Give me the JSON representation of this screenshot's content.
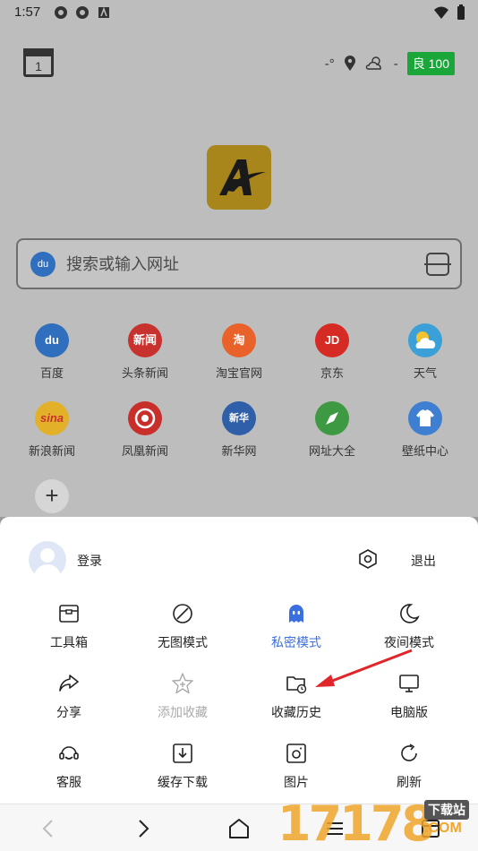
{
  "status_bar": {
    "time": "1:57"
  },
  "header": {
    "calendar_day": "1",
    "temperature": "-°",
    "weather_value": "-",
    "aqi": "良 100"
  },
  "search": {
    "placeholder": "搜索或输入网址"
  },
  "shortcuts": [
    {
      "label": "百度",
      "icon_text": "du",
      "color": "#2f6fbd"
    },
    {
      "label": "头条新闻",
      "icon_text": "新闻",
      "color": "#c8322e"
    },
    {
      "label": "淘宝官网",
      "icon_text": "淘",
      "color": "#e8622a"
    },
    {
      "label": "京东",
      "icon_text": "JD",
      "color": "#d62b24"
    },
    {
      "label": "天气",
      "icon_text": "",
      "color": "#3ba0d8"
    },
    {
      "label": "新浪新闻",
      "icon_text": "sina",
      "color": "#e2b129"
    },
    {
      "label": "凤凰新闻",
      "icon_text": "",
      "color": "#c92f2a"
    },
    {
      "label": "新华网",
      "icon_text": "新华",
      "color": "#2f5fa8"
    },
    {
      "label": "网址大全",
      "icon_text": "",
      "color": "#3e9a42"
    },
    {
      "label": "壁纸中心",
      "icon_text": "",
      "color": "#3f7fd1"
    }
  ],
  "sheet": {
    "login_label": "登录",
    "logout_label": "退出",
    "items": [
      {
        "label": "工具箱",
        "icon": "toolbox-icon"
      },
      {
        "label": "无图模式",
        "icon": "no-image-icon"
      },
      {
        "label": "私密模式",
        "icon": "ghost-icon"
      },
      {
        "label": "夜间模式",
        "icon": "moon-icon"
      },
      {
        "label": "分享",
        "icon": "share-icon"
      },
      {
        "label": "添加收藏",
        "icon": "star-add-icon"
      },
      {
        "label": "收藏历史",
        "icon": "folder-clock-icon"
      },
      {
        "label": "电脑版",
        "icon": "monitor-icon"
      },
      {
        "label": "客服",
        "icon": "headset-icon"
      },
      {
        "label": "缓存下载",
        "icon": "download-icon"
      },
      {
        "label": "图片",
        "icon": "photo-icon"
      },
      {
        "label": "刷新",
        "icon": "refresh-icon"
      }
    ]
  },
  "colors": {
    "accent": "#3b6fe0",
    "aqi_green": "#1aa638",
    "annotation_arrow": "#e0262a"
  },
  "watermark": {
    "digits": "17178",
    "tag": "下载站",
    "suffix": ".COM"
  }
}
